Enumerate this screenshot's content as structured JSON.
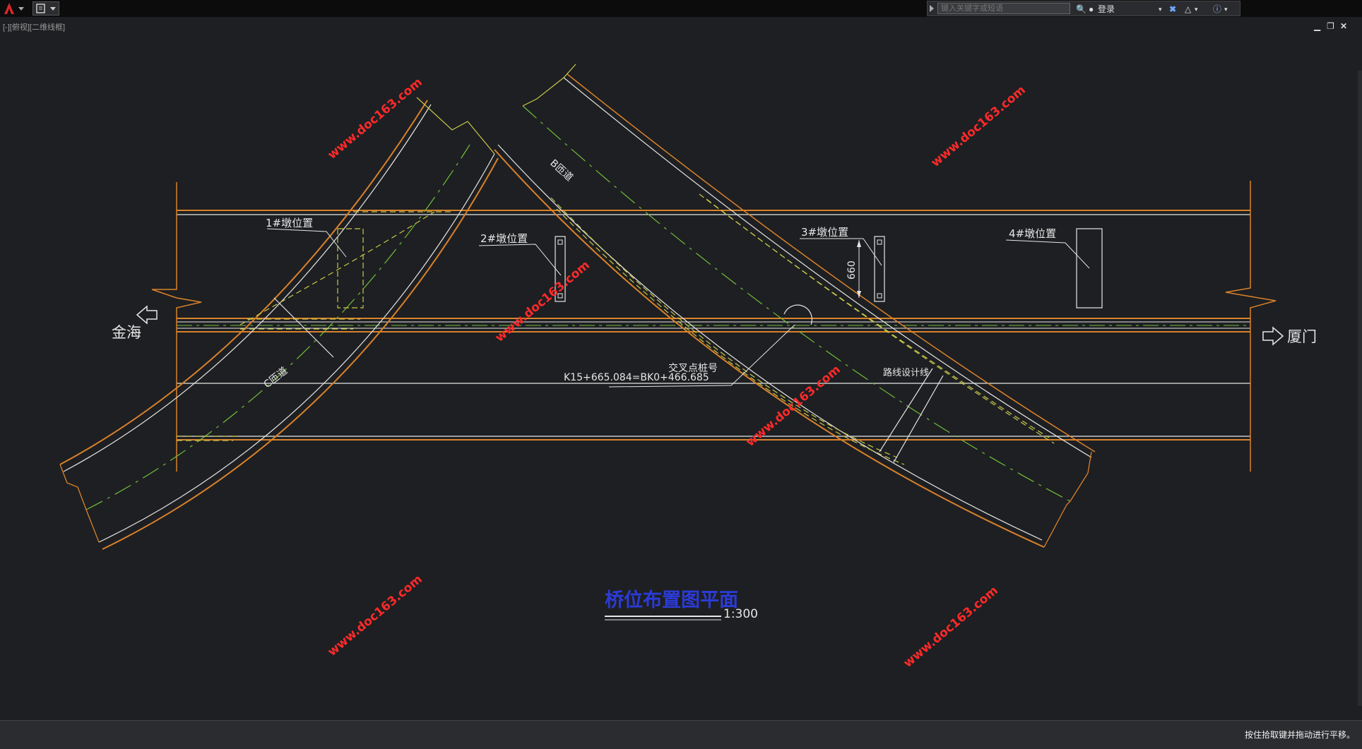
{
  "titlebar": {
    "search_placeholder": "键入关键字或短语",
    "login_label": "登录"
  },
  "viewport": {
    "label": "[-][俯视][二维线框]"
  },
  "drawing": {
    "pier1": "1#墩位置",
    "pier2": "2#墩位置",
    "pier3": "3#墩位置",
    "pier4": "4#墩位置",
    "dim_660": "660",
    "ramp_c": "C匝道",
    "ramp_b": "B匝道",
    "dir_left": "金海",
    "dir_right": "厦门",
    "cross_point_label": "交叉点桩号",
    "station": "K15+665.084=BK0+466.685",
    "route_line": "路线设计线",
    "title": "桥位布置图平面",
    "scale": "1:300",
    "watermark": "www.doc163.com"
  },
  "statusbar": {
    "hint": "按住拾取键并拖动进行平移。"
  },
  "colors": {
    "background": "#1e1f22",
    "road_orange": "#d9822b",
    "line_white": "#e6e6e6",
    "center_green": "#6fbf3a",
    "dashed_yellow": "#c8c84a",
    "watermark_red": "#ff2a2a",
    "title_blue": "#2b3bd6"
  }
}
